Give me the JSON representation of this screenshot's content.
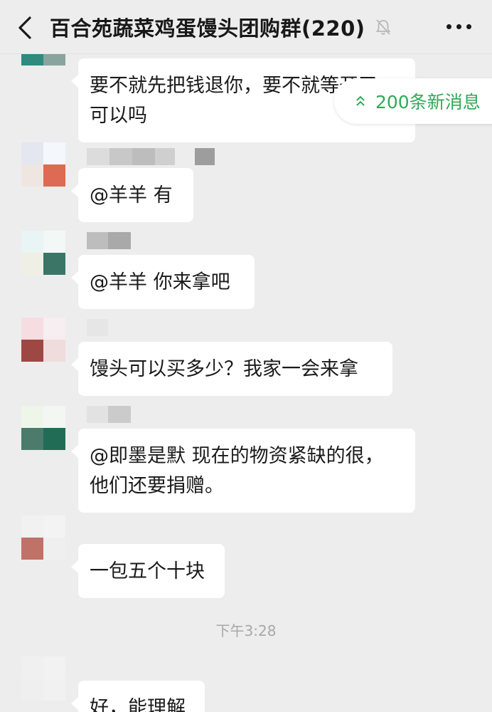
{
  "header": {
    "title": "百合苑蔬菜鸡蛋馒头团购群(220)",
    "back_icon": "chevron-left-icon",
    "mute_icon": "bell-muted-icon",
    "more_icon": "more-dots-icon"
  },
  "new_messages_pill": {
    "label": "200条新消息",
    "icon": "double-chevron-up-icon",
    "color": "#2eaa56"
  },
  "messages": [
    {
      "text": "要不就先把钱退你，要不就等开了\n可以吗"
    },
    {
      "text": "@羊羊  有"
    },
    {
      "text": "@羊羊  你来拿吧"
    },
    {
      "text": "馒头可以买多少？我家一会来拿"
    },
    {
      "text": "@即墨是默  现在的物资紧缺的很，\n他们还要捐赠。"
    },
    {
      "text": "一包五个十块"
    },
    {
      "text": "好，能理解"
    }
  ],
  "timestamp": "下午3:28"
}
